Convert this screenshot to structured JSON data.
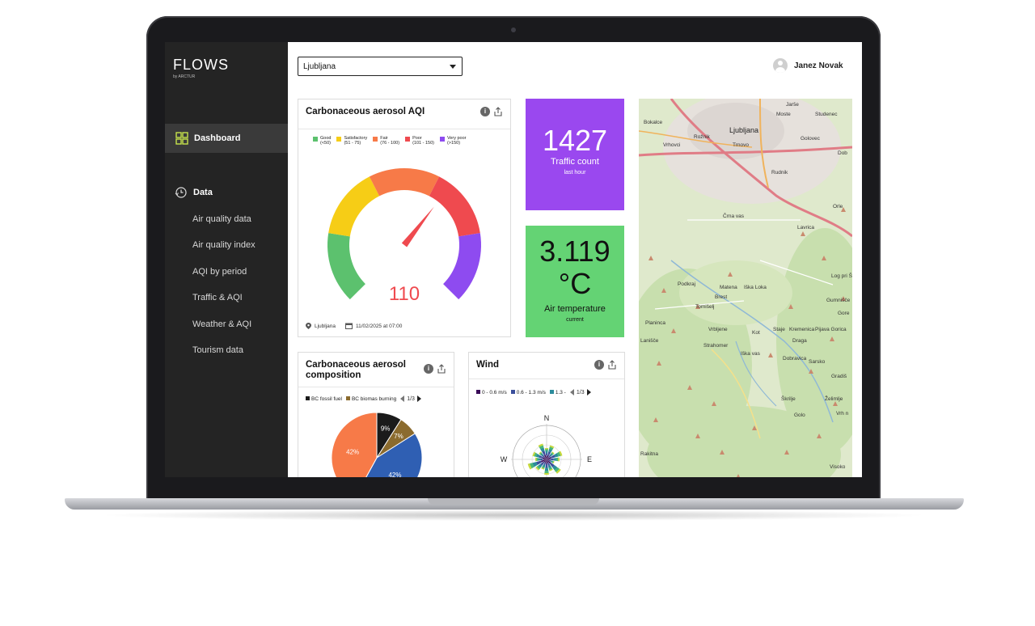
{
  "brand": {
    "name": "FLOWS",
    "sub": "by ARCTUR"
  },
  "sidebar": {
    "dashboard_label": "Dashboard",
    "data_label": "Data",
    "items": [
      {
        "label": "Air quality data"
      },
      {
        "label": "Air quality index"
      },
      {
        "label": "AQI by period"
      },
      {
        "label": "Traffic & AQI"
      },
      {
        "label": "Weather & AQI"
      },
      {
        "label": "Tourism data"
      }
    ]
  },
  "topbar": {
    "city_select": "Ljubljana",
    "user_name": "Janez Novak"
  },
  "aqi_card": {
    "title": "Carbonaceous aerosol AQI",
    "legend": [
      {
        "name": "Good",
        "range": "(<50)",
        "color": "#5cc16e"
      },
      {
        "name": "Satisfactory",
        "range": "(51 - 75)",
        "color": "#f6cd16"
      },
      {
        "name": "Fair",
        "range": "(76 - 100)",
        "color": "#f77a48"
      },
      {
        "name": "Poor",
        "range": "(101 - 150)",
        "color": "#ef4a4f"
      },
      {
        "name": "Very poor",
        "range": "(>150)",
        "color": "#8e4bf0"
      }
    ],
    "value": "110",
    "value_color": "#ef4a4f",
    "location": "Ljubljana",
    "timestamp": "11/02/2025 at 07:00"
  },
  "traffic": {
    "value": "1427",
    "label": "Traffic count",
    "sub": "last hour",
    "color": "#9a48ef"
  },
  "temperature": {
    "value": "3.119",
    "unit": "°C",
    "label": "Air temperature",
    "sub": "current",
    "color": "#64d374"
  },
  "composition": {
    "title": "Carbonaceous aerosol composition",
    "legend": [
      {
        "name": "BC fossil fuel",
        "color": "#1b1b1b"
      },
      {
        "name": "BC biomas burning",
        "color": "#8b6b2e"
      }
    ],
    "pager": "1/3",
    "slices": [
      {
        "label": "9%",
        "value": 9,
        "color": "#1b1b1b"
      },
      {
        "label": "7%",
        "value": 7,
        "color": "#8b6b2e"
      },
      {
        "label": "42%",
        "value": 42,
        "color": "#2f5fb3"
      },
      {
        "label": "42%",
        "value": 42,
        "color": "#f77a48"
      }
    ]
  },
  "wind": {
    "title": "Wind",
    "legend": [
      {
        "name": "0 - 0.6 m/s",
        "color": "#3a0b58"
      },
      {
        "name": "0.6 - 1.3 m/s",
        "color": "#3b4f9b"
      },
      {
        "name": "1.3 -",
        "color": "#2b8c9c"
      }
    ],
    "pager": "1/3",
    "north": "N",
    "east": "E",
    "west": "W"
  },
  "map": {
    "labels": [
      "Jarše",
      "Moste",
      "Studenec",
      "Bokalce",
      "Ljubljana",
      "Rožnik",
      "Vrhovci",
      "Trnovo",
      "Golovec",
      "Dob",
      "Rudnik",
      "Orle",
      "Črna vas",
      "Lavrica",
      "Podkraj",
      "Matena",
      "Iška Loka",
      "Brest",
      "Tomišelj",
      "Gumnišče",
      "Planinca",
      "Vrbljene",
      "Staje",
      "Kot",
      "Kremenica",
      "Pijava Gorica",
      "Strahomer",
      "Draga",
      "Iška vas",
      "Dobravica",
      "Sarsko",
      "Škrilje",
      "Golo",
      "Želimlje",
      "Rakitna",
      "Visoko",
      "Lanišče",
      "Gradiš",
      "Gore",
      "Log pri Š",
      "Vrh n"
    ]
  }
}
